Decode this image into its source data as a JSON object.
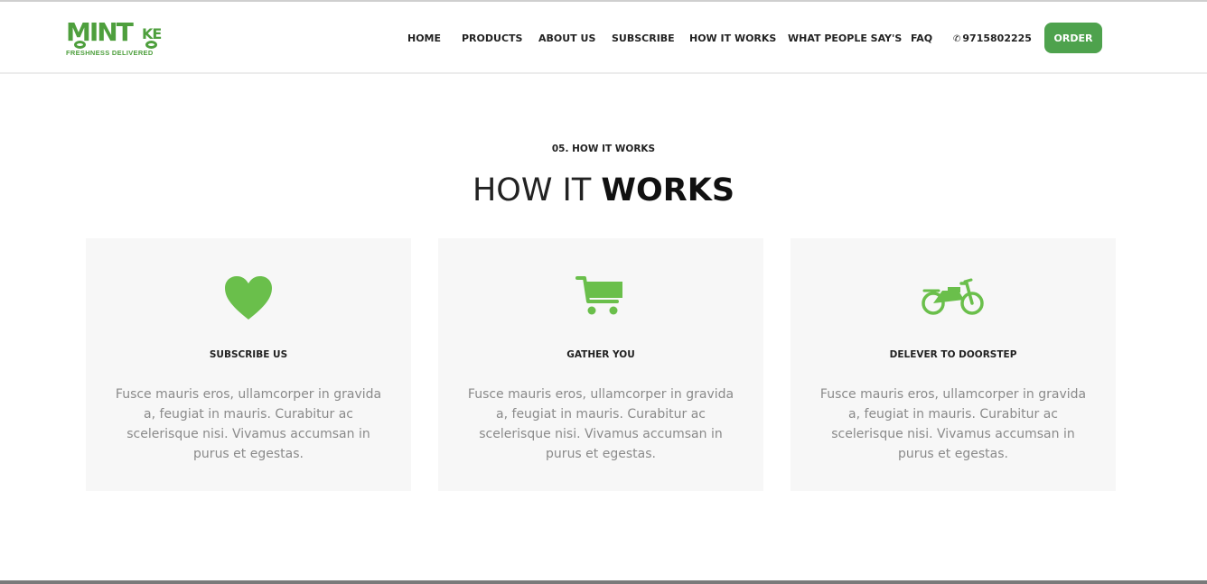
{
  "brand": {
    "logo_text": "MINT",
    "logo_suffix": "KE",
    "tagline": "FRESHNESS DELIVERED",
    "color": "#4e9f3d"
  },
  "nav": {
    "items": [
      {
        "label": "HOME"
      },
      {
        "label": "PRODUCTS"
      },
      {
        "label": "ABOUT US"
      },
      {
        "label": "SUBSCRIBE"
      },
      {
        "label": "HOW IT WORKS"
      },
      {
        "label": "WHAT PEOPLE SAY'S"
      },
      {
        "label": "FAQ"
      }
    ],
    "phone": "9715802225",
    "phone_icon": "phone-icon",
    "order_label": "ORDER",
    "order_color": "#4ea24d"
  },
  "section": {
    "eyebrow": "05. HOW IT WORKS",
    "title_light": "HOW IT",
    "title_bold": "WORKS"
  },
  "cards": [
    {
      "icon": "heart-icon",
      "title": "SUBSCRIBE US",
      "text": "Fusce mauris eros, ullamcorper in gravida a, feugiat in mauris. Curabitur ac scelerisque nisi. Vivamus accumsan in purus et egestas."
    },
    {
      "icon": "shopping-cart-icon",
      "title": "GATHER YOU",
      "text": "Fusce mauris eros, ullamcorper in gravida a, feugiat in mauris. Curabitur ac scelerisque nisi. Vivamus accumsan in purus et egestas."
    },
    {
      "icon": "motorcycle-icon",
      "title": "DELEVER TO DOORSTEP",
      "text": "Fusce mauris eros, ullamcorper in gravida a, feugiat in mauris. Curabitur ac scelerisque nisi. Vivamus accumsan in purus et egestas."
    }
  ],
  "colors": {
    "accent": "#6abf4b",
    "card_bg": "#f7f7f7",
    "body_text": "#8a8a8a"
  }
}
